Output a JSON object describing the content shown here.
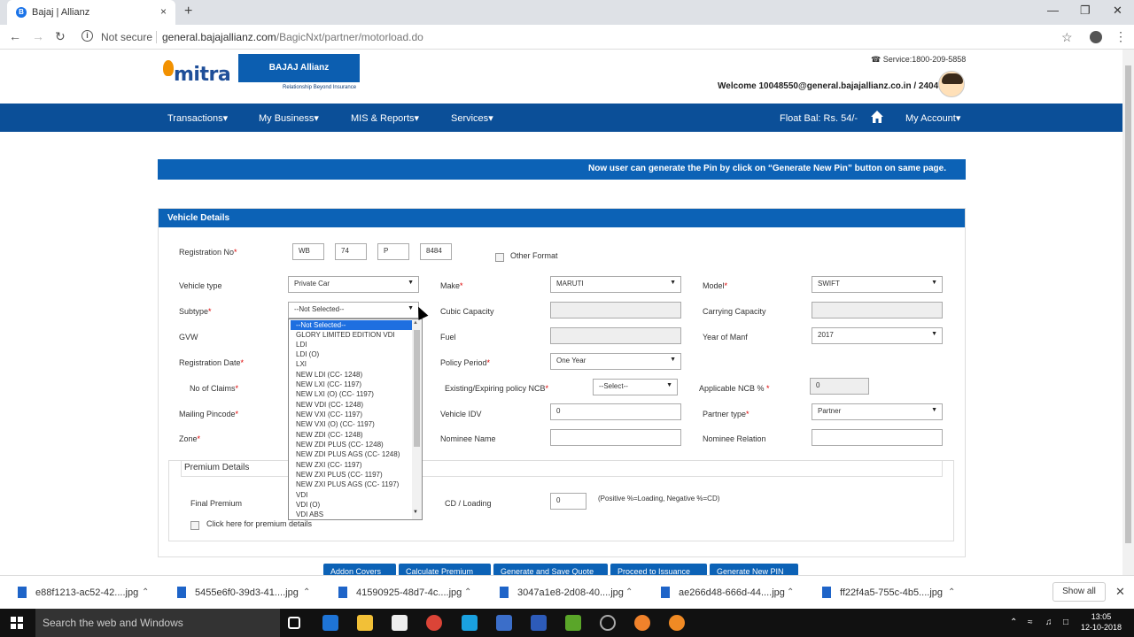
{
  "browser": {
    "tab_title": "Bajaj | Allianz",
    "not_secure": "Not secure",
    "url_host": "general.bajajallianz.com",
    "url_path": "/BagicNxt/partner/motorload.do",
    "new_tab": "+",
    "close": "×"
  },
  "header": {
    "mitra_logo": "mitra",
    "bajaj_logo": "BAJAJ Allianz",
    "bajaj_tagline": "Relationship Beyond Insurance",
    "service": "Service:1800-209-5858",
    "welcome": "Welcome 10048550@general.bajajallianz.co.in / 2404"
  },
  "nav": {
    "items": [
      "Transactions",
      "My Business",
      "MIS & Reports",
      "Services"
    ],
    "float_bal": "Float Bal: Rs. 54/-",
    "my_account": "My Account"
  },
  "notice": "Now user can generate the Pin by click on “Generate New Pin” button on same page.",
  "vehicle": {
    "title": "Vehicle Details",
    "registration_label": "Registration No",
    "reg_parts": [
      "WB",
      "74",
      "P",
      "8484"
    ],
    "other_format": "Other Format",
    "vehicle_type_label": "Vehicle type",
    "vehicle_type": "Private Car",
    "make_label": "Make",
    "make": "MARUTI",
    "model_label": "Model",
    "model": "SWIFT",
    "subtype_label": "Subtype",
    "subtype": "--Not Selected--",
    "cubic_label": "Cubic Capacity",
    "carrying_label": "Carrying Capacity",
    "gvw_label": "GVW",
    "fuel_label": "Fuel",
    "year_label": "Year of Manf",
    "year": "2017",
    "regdate_label": "Registration Date",
    "policy_period_label": "Policy Period",
    "policy_period": "One Year",
    "claims_label": "No of Claims",
    "ncb_label": "Existing/Expiring policy NCB",
    "ncb": "--Select--",
    "app_ncb_label": "Applicable NCB %",
    "app_ncb": "0",
    "pincode_label": "Mailing Pincode",
    "idv_label": "Vehicle IDV",
    "idv": "0",
    "partner_type_label": "Partner type",
    "partner_type": "Partner",
    "zone_label": "Zone",
    "nominee_label": "Nominee Name",
    "nominee_rel_label": "Nominee Relation"
  },
  "premium": {
    "title": "Premium Details",
    "final_label": "Final Premium",
    "cd_label": "CD / Loading",
    "cd_value": "0",
    "cd_hint": "(Positive %=Loading, Negative %=CD)",
    "click_details": "Click here for premium details"
  },
  "buttons": [
    "Addon Covers",
    "Calculate Premium",
    "Generate and Save Quote",
    "Proceed to Issuance",
    "Generate New PIN"
  ],
  "subtype_options": [
    "--Not Selected--",
    "GLORY LIMITED EDITION VDI",
    "LDI",
    "LDI (O)",
    "LXI",
    "NEW LDI (CC- 1248)",
    "NEW LXI (CC- 1197)",
    "NEW LXI (O) (CC- 1197)",
    "NEW VDI (CC- 1248)",
    "NEW VXI (CC- 1197)",
    "NEW VXI (O) (CC- 1197)",
    "NEW ZDI (CC- 1248)",
    "NEW ZDI PLUS (CC- 1248)",
    "NEW ZDI PLUS AGS (CC- 1248)",
    "NEW ZXI (CC- 1197)",
    "NEW ZXI PLUS (CC- 1197)",
    "NEW ZXI PLUS AGS (CC- 1197)",
    "VDI",
    "VDI (O)",
    "VDI ABS"
  ],
  "downloads": [
    "e88f1213-ac52-42....jpg",
    "5455e6f0-39d3-41....jpg",
    "41590925-48d7-4c....jpg",
    "3047a1e8-2d08-40....jpg",
    "ae266d48-666d-44....jpg",
    "ff22f4a5-755c-4b5....jpg"
  ],
  "show_all": "Show all",
  "taskbar": {
    "search": "Search the web and Windows",
    "time": "13:05",
    "date": "12-10-2018"
  },
  "colors": {
    "brand_blue": "#0b4f98",
    "panel_blue": "#0c62b6"
  }
}
